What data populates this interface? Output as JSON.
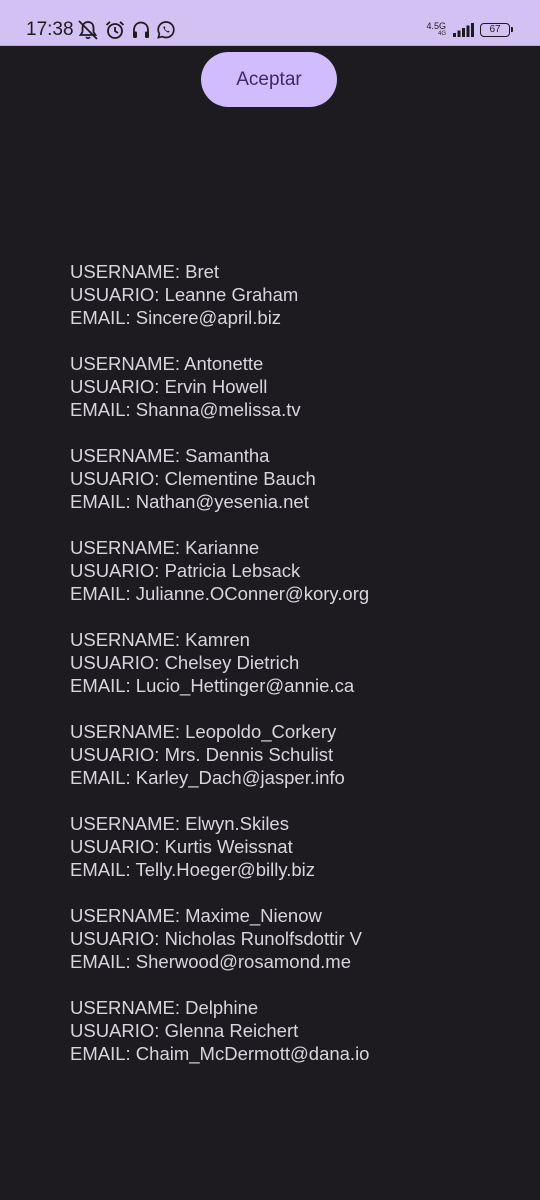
{
  "status_bar": {
    "time": "17:38",
    "network_type": "4.5G",
    "network_sub": "4G",
    "battery_level": "67",
    "icons": [
      "notifications-off-icon",
      "alarm-icon",
      "headphones-icon",
      "whatsapp-icon",
      "signal-icon",
      "battery-icon"
    ]
  },
  "accept_button": {
    "label": "Aceptar"
  },
  "users": [
    {
      "username_line": "USERNAME: Bret",
      "usuario_line": "USUARIO: Leanne Graham",
      "email_line": "EMAIL: Sincere@april.biz"
    },
    {
      "username_line": "USERNAME: Antonette",
      "usuario_line": "USUARIO: Ervin Howell",
      "email_line": "EMAIL: Shanna@melissa.tv"
    },
    {
      "username_line": "USERNAME: Samantha",
      "usuario_line": "USUARIO: Clementine Bauch",
      "email_line": "EMAIL: Nathan@yesenia.net"
    },
    {
      "username_line": "USERNAME: Karianne",
      "usuario_line": "USUARIO: Patricia Lebsack",
      "email_line": "EMAIL: Julianne.OConner@kory.org"
    },
    {
      "username_line": "USERNAME: Kamren",
      "usuario_line": "USUARIO: Chelsey Dietrich",
      "email_line": "EMAIL: Lucio_Hettinger@annie.ca"
    },
    {
      "username_line": "USERNAME: Leopoldo_Corkery",
      "usuario_line": "USUARIO: Mrs. Dennis Schulist",
      "email_line": "EMAIL: Karley_Dach@jasper.info"
    },
    {
      "username_line": "USERNAME: Elwyn.Skiles",
      "usuario_line": "USUARIO: Kurtis Weissnat",
      "email_line": "EMAIL: Telly.Hoeger@billy.biz"
    },
    {
      "username_line": "USERNAME: Maxime_Nienow",
      "usuario_line": "USUARIO: Nicholas Runolfsdottir V",
      "email_line": "EMAIL: Sherwood@rosamond.me"
    },
    {
      "username_line": "USERNAME: Delphine",
      "usuario_line": "USUARIO: Glenna Reichert",
      "email_line": "EMAIL: Chaim_McDermott@dana.io"
    }
  ]
}
